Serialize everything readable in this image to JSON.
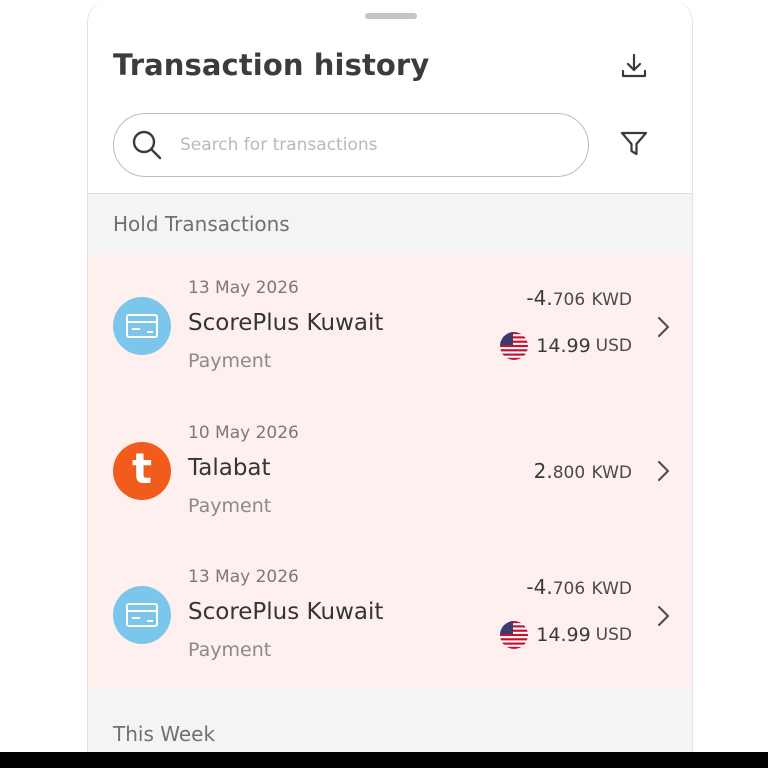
{
  "header": {
    "title": "Transaction history",
    "download_icon": "download-icon",
    "filter_icon": "filter-icon"
  },
  "search": {
    "placeholder": "Search for transactions",
    "value": "",
    "icon": "search-icon"
  },
  "sections": {
    "hold_label": "Hold Transactions",
    "week_label": "This Week"
  },
  "transactions": [
    {
      "date": "13 May 2026",
      "merchant": "ScorePlus Kuwait",
      "type": "Payment",
      "amount_main": "-4.",
      "amount_fraction": "706",
      "currency": "KWD",
      "foreign_amount": "14.99",
      "foreign_currency": "USD",
      "icon": "card-icon"
    },
    {
      "date": "10 May 2026",
      "merchant": "Talabat",
      "type": "Payment",
      "amount_main": "2.",
      "amount_fraction": "800",
      "currency": "KWD",
      "icon": "talabat-logo-icon",
      "logo_letter": "t"
    },
    {
      "date": "13 May 2026",
      "merchant": "ScorePlus Kuwait",
      "type": "Payment",
      "amount_main": "-4.",
      "amount_fraction": "706",
      "currency": "KWD",
      "foreign_amount": "14.99",
      "foreign_currency": "USD",
      "icon": "card-icon"
    }
  ],
  "colors": {
    "hold_background": "#fdf0ee",
    "card_icon": "#7cc6ec",
    "talabat_brand": "#f15b1c"
  }
}
